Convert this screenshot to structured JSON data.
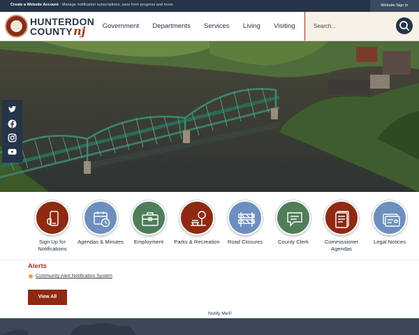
{
  "topbar": {
    "create_account": "Create a Website Account",
    "message": " - Manage notification subscriptions, save form progress and more.",
    "sign_in": "Website Sign In"
  },
  "logo": {
    "line1": "HUNTERDON",
    "line2": "COUNTY",
    "nj": "nj"
  },
  "nav": [
    {
      "label": "Government"
    },
    {
      "label": "Departments"
    },
    {
      "label": "Services"
    },
    {
      "label": "Living"
    },
    {
      "label": "Visiting"
    }
  ],
  "search": {
    "placeholder": "Search..."
  },
  "social": [
    "twitter-icon",
    "facebook-icon",
    "instagram-icon",
    "youtube-icon"
  ],
  "quick_links": [
    {
      "label": "Sign Up for Notifications",
      "color": "#8e2a12",
      "icon": "phone-icon"
    },
    {
      "label": "Agendas & Minutes",
      "color": "#6d8fbd",
      "icon": "calendar-clock-icon"
    },
    {
      "label": "Employment",
      "color": "#4f7d5a",
      "icon": "briefcase-icon"
    },
    {
      "label": "Parks & Recreation",
      "color": "#8e2a12",
      "icon": "park-icon"
    },
    {
      "label": "Road Closures",
      "color": "#6d8fbd",
      "icon": "barrier-icon"
    },
    {
      "label": "County Clerk",
      "color": "#4f7d5a",
      "icon": "chat-icon"
    },
    {
      "label": "Commissioner Agendas",
      "color": "#8e2a12",
      "icon": "document-icon"
    },
    {
      "label": "Legal Notices",
      "color": "#6d8fbd",
      "icon": "card-icon"
    }
  ],
  "alerts": {
    "title": "Alerts",
    "item": "Community Alert Notification System",
    "view_all": "View All",
    "notify": "Notify Me®"
  },
  "colors": {
    "navy": "#263448",
    "brand_red": "#a33820",
    "cream": "#f7f1e7"
  }
}
